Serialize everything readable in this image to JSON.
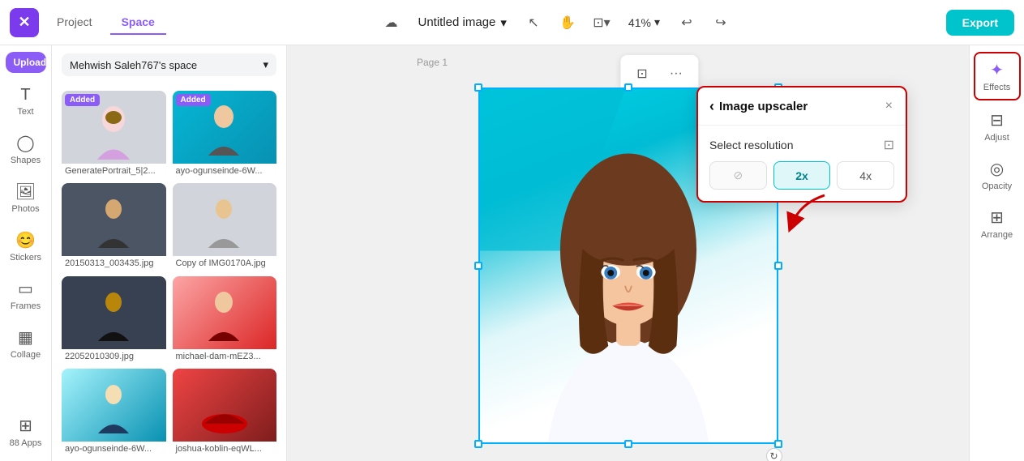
{
  "topbar": {
    "logo": "✕",
    "nav_project": "Project",
    "nav_space": "Space",
    "file_title": "Untitled image",
    "file_dropdown_icon": "▾",
    "cloud_icon": "☁",
    "cursor_icon": "↖",
    "hand_icon": "✋",
    "layout_icon": "⊡",
    "zoom_level": "41%",
    "zoom_dropdown": "▾",
    "undo_icon": "↩",
    "redo_icon": "↪",
    "export_label": "Export"
  },
  "sidebar": {
    "upload_label": "Upload",
    "items": [
      {
        "id": "text",
        "icon": "T",
        "label": "Text"
      },
      {
        "id": "shapes",
        "icon": "◯",
        "label": "Shapes"
      },
      {
        "id": "photos",
        "icon": "🖼",
        "label": "Photos"
      },
      {
        "id": "stickers",
        "icon": "😊",
        "label": "Stickers"
      },
      {
        "id": "frames",
        "icon": "⊞",
        "label": "Frames"
      },
      {
        "id": "collage",
        "icon": "▦",
        "label": "Collage"
      },
      {
        "id": "apps",
        "icon": "⊞",
        "label": "Apps"
      }
    ]
  },
  "panel": {
    "space_name": "Mehwish Saleh767's space",
    "dropdown_icon": "▾",
    "media_items": [
      {
        "id": 1,
        "name": "GeneratePortrait_5|2...",
        "added": true,
        "color": "purple"
      },
      {
        "id": 2,
        "name": "ayo-ogunseinde-6W...",
        "added": true,
        "color": "teal"
      },
      {
        "id": 3,
        "name": "20150313_003435.jpg",
        "added": false,
        "color": "dark"
      },
      {
        "id": 4,
        "name": "Copy of IMG0170A.jpg",
        "added": false,
        "color": "white"
      },
      {
        "id": 5,
        "name": "22052010309.jpg",
        "added": false,
        "color": "dark"
      },
      {
        "id": 6,
        "name": "michael-dam-mEZ3...",
        "added": false,
        "color": "red"
      },
      {
        "id": 7,
        "name": "ayo-ogunseinde-6W...",
        "added": false,
        "color": "teal"
      },
      {
        "id": 8,
        "name": "joshua-koblin-eqWL...",
        "added": false,
        "color": "red"
      }
    ]
  },
  "canvas": {
    "page_label": "Page 1",
    "toolbar_icons": [
      "⊡",
      "···"
    ]
  },
  "upscaler": {
    "back_icon": "‹",
    "title": "Image upscaler",
    "close_icon": "×",
    "resolution_label": "Select resolution",
    "monitor_icon": "⊡",
    "options": [
      {
        "id": "none",
        "label": "⊘",
        "active": false,
        "disabled": true
      },
      {
        "id": "2x",
        "label": "2x",
        "active": true,
        "disabled": false
      },
      {
        "id": "4x",
        "label": "4x",
        "active": false,
        "disabled": false
      }
    ]
  },
  "right_panel": {
    "items": [
      {
        "id": "effects",
        "icon": "✦",
        "label": "Effects",
        "active": true
      },
      {
        "id": "adjust",
        "icon": "⊟",
        "label": "Adjust"
      },
      {
        "id": "opacity",
        "icon": "◎",
        "label": "Opacity"
      },
      {
        "id": "arrange",
        "icon": "⊞",
        "label": "Arrange"
      }
    ]
  },
  "apps_label": "88 Apps"
}
